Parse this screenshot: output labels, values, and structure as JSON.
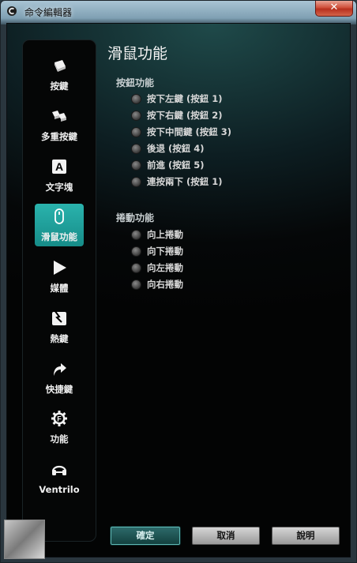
{
  "window": {
    "title": "命令編輯器",
    "close_label": "✕"
  },
  "sidebar": {
    "items": [
      {
        "label": "按鍵",
        "icon": "key-icon"
      },
      {
        "label": "多重按鍵",
        "icon": "multi-key-icon"
      },
      {
        "label": "文字塊",
        "icon": "text-block-icon"
      },
      {
        "label": "滑鼠功能",
        "icon": "mouse-icon",
        "active": true
      },
      {
        "label": "媒體",
        "icon": "play-icon"
      },
      {
        "label": "熱鍵",
        "icon": "hotkey-icon"
      },
      {
        "label": "快捷鍵",
        "icon": "shortcut-arrow-icon"
      },
      {
        "label": "功能",
        "icon": "function-gear-icon"
      },
      {
        "label": "Ventrilo",
        "icon": "headset-icon"
      }
    ]
  },
  "main": {
    "title": "滑鼠功能",
    "button_section": {
      "title": "按鈕功能",
      "options": [
        "按下左鍵 (按鈕 1)",
        "按下右鍵 (按鈕 2)",
        "按下中間鍵 (按鈕 3)",
        "後退 (按鈕 4)",
        "前進 (按鈕 5)",
        "連按兩下 (按鈕 1)"
      ]
    },
    "scroll_section": {
      "title": "捲動功能",
      "options": [
        "向上捲動",
        "向下捲動",
        "向左捲動",
        "向右捲動"
      ]
    }
  },
  "footer": {
    "ok_label": "確定",
    "cancel_label": "取消",
    "help_label": "說明"
  },
  "colors": {
    "accent": "#22a8a3",
    "background": "#050708"
  }
}
